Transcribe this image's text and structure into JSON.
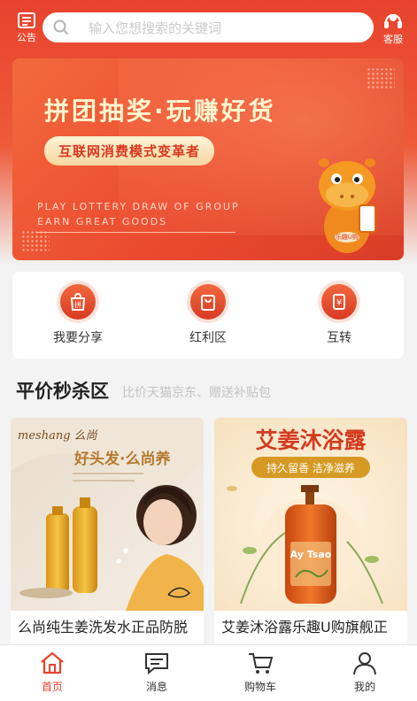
{
  "header": {
    "notice_label": "公告",
    "search_placeholder": "输入您想搜索的关键词",
    "service_label": "客服"
  },
  "banner": {
    "title": "拼团抽奖·玩赚好货",
    "pill": "互联网消费模式变革者",
    "en_line1": "PLAY LOTTERY DRAW OF GROUP",
    "en_line2": "EARN GREAT GOODS",
    "mascot_tag": "乐趣U购"
  },
  "categories": [
    {
      "label": "我要分享",
      "icon": "share-bag-icon",
      "glyph": "拼"
    },
    {
      "label": "红利区",
      "icon": "bag-icon"
    },
    {
      "label": "互转",
      "icon": "transfer-icon",
      "glyph": "¥"
    }
  ],
  "section": {
    "title": "平价秒杀区",
    "subtitle": "比价天猫京东、赠送补贴包"
  },
  "products": [
    {
      "name": "么尚纯生姜洗发水正品防脱",
      "brand": "meshang 么尚",
      "slogan": "好头发·么尚养"
    },
    {
      "name": "艾姜沐浴露乐趣U购旗舰正",
      "headline": "艾姜沐浴露",
      "tagline": "持久留香 洁净滋养",
      "bottle_label": "Ay Tsao"
    }
  ],
  "tabbar": [
    {
      "label": "首页",
      "icon": "home-icon"
    },
    {
      "label": "消息",
      "icon": "message-icon"
    },
    {
      "label": "购物车",
      "icon": "cart-icon"
    },
    {
      "label": "我的",
      "icon": "profile-icon"
    }
  ],
  "colors": {
    "brand_red": "#e8432e",
    "active_tab": "#e8432e",
    "banner_text": "#fff6cf"
  }
}
